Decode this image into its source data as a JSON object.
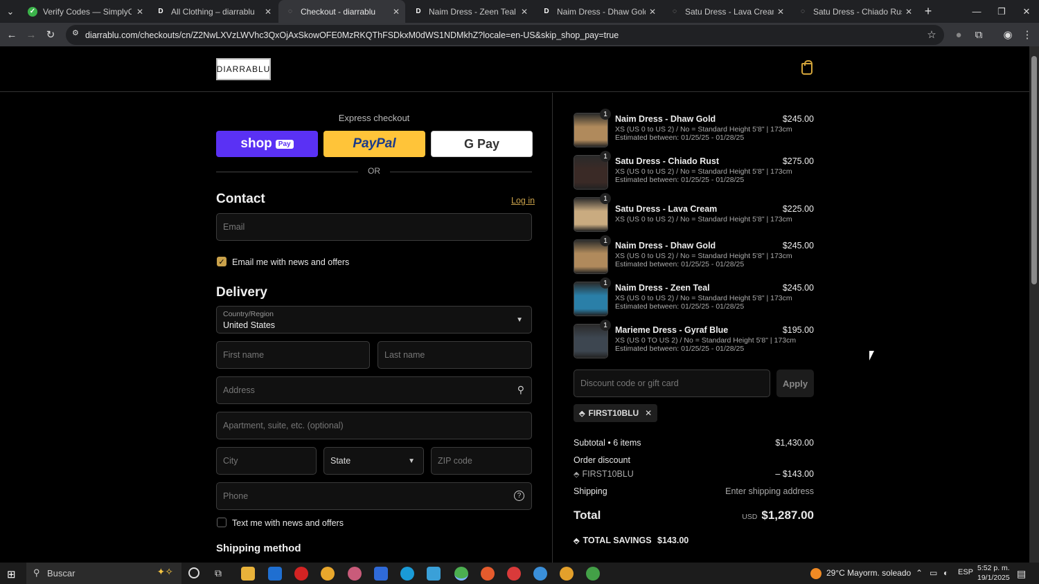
{
  "browser": {
    "tabs": [
      {
        "title": "Verify Codes — SimplyCodes",
        "active": false
      },
      {
        "title": "All Clothing – diarrablu",
        "active": false
      },
      {
        "title": "Checkout - diarrablu",
        "active": true
      },
      {
        "title": "Naim Dress - Zeen Teal – diarr",
        "active": false
      },
      {
        "title": "Naim Dress - Dhaw Gold – dia",
        "active": false
      },
      {
        "title": "Satu Dress - Lava Cream – diarr",
        "active": false
      },
      {
        "title": "Satu Dress - Chiado Rust – diar",
        "active": false
      }
    ],
    "url": "diarrablu.com/checkouts/cn/Z2NwLXVzLWVhc3QxOjAxSkowOFE0MzRKQThFSDkxM0dWS1NDMkhZ?locale=en-US&skip_shop_pay=true"
  },
  "header": {
    "logo": "DIARRABLU"
  },
  "express": {
    "title": "Express checkout",
    "shop_pay": "shop",
    "shop_pay_badge": "Pay",
    "paypal": "PayPal",
    "gpay": "G Pay",
    "or": "OR"
  },
  "contact": {
    "heading": "Contact",
    "login": "Log in",
    "email_placeholder": "Email",
    "email_news": "Email me with news and offers"
  },
  "delivery": {
    "heading": "Delivery",
    "country_label": "Country/Region",
    "country_value": "United States",
    "first_name": "First name",
    "last_name": "Last name",
    "address": "Address",
    "apartment": "Apartment, suite, etc. (optional)",
    "city": "City",
    "state": "State",
    "zip": "ZIP code",
    "phone": "Phone",
    "text_news": "Text me with news and offers",
    "shipping_method": "Shipping method"
  },
  "items": [
    {
      "qty": "1",
      "name": "Naim Dress - Dhaw Gold",
      "variant": "XS (US 0 to US 2) / No = Standard Height 5'8\" | 173cm",
      "estimate": "Estimated between: 01/25/25 - 01/28/25",
      "price": "$245.00",
      "color": "#b08a5c"
    },
    {
      "qty": "1",
      "name": "Satu Dress - Chiado Rust",
      "variant": "XS (US 0 to US 2) / No = Standard Height 5'8\" | 173cm",
      "estimate": "Estimated between: 01/25/25 - 01/28/25",
      "price": "$275.00",
      "color": "#3a2a26"
    },
    {
      "qty": "1",
      "name": "Satu Dress - Lava Cream",
      "variant": "XS (US 0 to US 2) / No = Standard Height 5'8\" | 173cm",
      "estimate": "",
      "price": "$225.00",
      "color": "#c9ab80"
    },
    {
      "qty": "1",
      "name": "Naim Dress - Dhaw Gold",
      "variant": "XS (US 0 to US 2) / No = Standard Height 5'8\" | 173cm",
      "estimate": "Estimated between: 01/25/25 - 01/28/25",
      "price": "$245.00",
      "color": "#b08a5c"
    },
    {
      "qty": "1",
      "name": "Naim Dress - Zeen Teal",
      "variant": "XS (US 0 to US 2) / No = Standard Height 5'8\" | 173cm",
      "estimate": "Estimated between: 01/25/25 - 01/28/25",
      "price": "$245.00",
      "color": "#2a7fa8"
    },
    {
      "qty": "1",
      "name": "Marieme Dress - Gyraf Blue",
      "variant": "XS (US 0 TO US 2) / No = Standard Height 5'8\" | 173cm",
      "estimate": "Estimated between: 01/25/25 - 01/28/25",
      "price": "$195.00",
      "color": "#3d4650"
    }
  ],
  "summary": {
    "discount_placeholder": "Discount code or gift card",
    "apply": "Apply",
    "code_chip": "FIRST10BLU",
    "subtotal_label": "Subtotal • 6 items",
    "subtotal_value": "$1,430.00",
    "order_discount_label": "Order discount",
    "discount_code": "FIRST10BLU",
    "discount_value": "– $143.00",
    "shipping_label": "Shipping",
    "shipping_value": "Enter shipping address",
    "total_label": "Total",
    "currency": "USD",
    "total_value": "$1,287.00",
    "savings_label": "TOTAL SAVINGS",
    "savings_value": "$143.00"
  },
  "taskbar": {
    "search": "Buscar",
    "weather": "29°C  Mayorm. soleado",
    "lang": "ESP",
    "time": "5:52 p. m.",
    "date": "19/1/2025"
  },
  "colors": {
    "shop_pay": "#5a31f4",
    "paypal": "#ffc439",
    "accent_gold": "#c9a14a"
  }
}
